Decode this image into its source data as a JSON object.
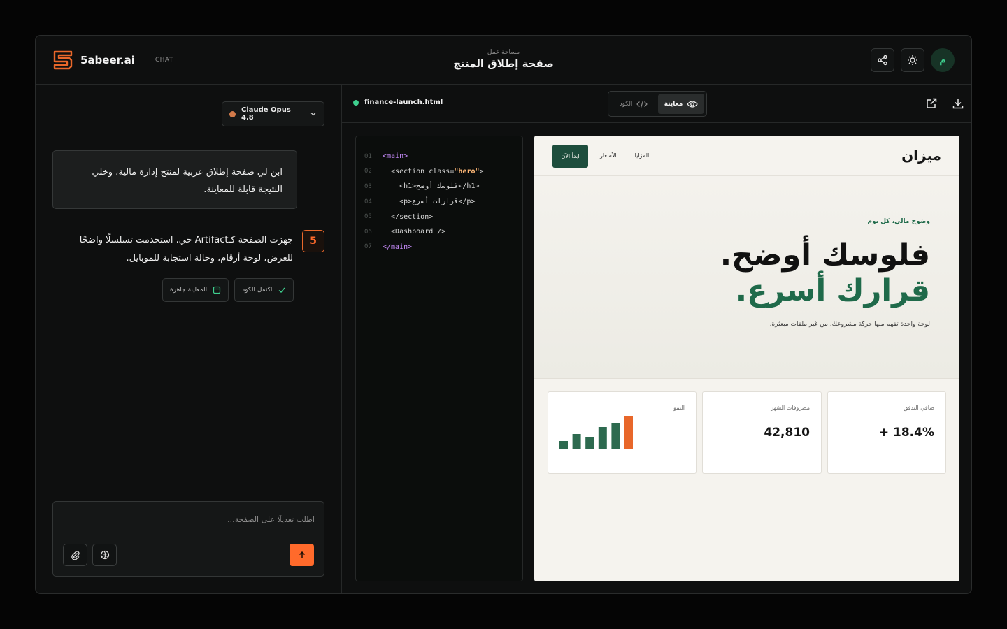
{
  "header": {
    "brand": "5abeer.ai",
    "mode": "CHAT",
    "workspace_label": "مساحة عمل",
    "title": "صفحة إطلاق المنتج",
    "avatar_initial": "م",
    "share_icon": "share-icon",
    "theme_icon": "sun-icon"
  },
  "chat": {
    "model": "Claude Opus 4.8",
    "user_message": "ابن لي صفحة إطلاق عربية لمنتج إدارة مالية، وخلي النتيجة قابلة للمعاينة.",
    "assistant_badge": "5",
    "assistant_message": "جهزت الصفحة كـArtifact حي. استخدمت تسلسلًا واضحًا للعرض، لوحة أرقام، وحالة استجابة للموبايل.",
    "chips": [
      {
        "label": "المعاينة جاهزة",
        "icon": "window-icon"
      },
      {
        "label": "اكتمل الكود",
        "icon": "check-icon"
      }
    ],
    "composer_placeholder": "اطلب تعديلًا على الصفحة..."
  },
  "artifact": {
    "file_name": "finance-launch.html",
    "tabs": [
      {
        "label": "الكود",
        "icon": "code-icon",
        "active": false
      },
      {
        "label": "معاينة",
        "icon": "eye-icon",
        "active": true
      }
    ],
    "code_lines": [
      {
        "n": "01",
        "parts": [
          [
            "tag",
            "<main>"
          ]
        ]
      },
      {
        "n": "02",
        "parts": [
          [
            "txt",
            "  <section class="
          ],
          [
            "str",
            "\"hero\""
          ],
          [
            "txt",
            ">"
          ]
        ]
      },
      {
        "n": "03",
        "parts": [
          [
            "txt",
            "    <h1>فلوسك أوضح</h1>"
          ]
        ]
      },
      {
        "n": "04",
        "parts": [
          [
            "txt",
            "    <p>قرارات أسرع</p>"
          ]
        ]
      },
      {
        "n": "05",
        "parts": [
          [
            "txt",
            "  </section>"
          ]
        ]
      },
      {
        "n": "06",
        "parts": [
          [
            "txt",
            "  <Dashboard />"
          ]
        ]
      },
      {
        "n": "07",
        "parts": [
          [
            "tag",
            "</main>"
          ]
        ]
      }
    ],
    "preview": {
      "logo": "ميزان",
      "nav_links": [
        "المزايا",
        "الأسعار"
      ],
      "cta": "ابدأ الآن",
      "eyebrow": "وضوح مالي، كل يوم",
      "headline_1": "فلوسك أوضح.",
      "headline_2": "قرارك أسرع.",
      "subtitle": "لوحة واحدة تفهم منها حركة مشروعك، من غير ملفات مبعثرة.",
      "cards": [
        {
          "label": "النمو",
          "value": ""
        },
        {
          "label": "مصروفات الشهر",
          "value": "42,810"
        },
        {
          "label": "صافي التدفق",
          "value": "+ 18.4%"
        }
      ]
    }
  },
  "chart_data": {
    "type": "bar",
    "categories": [
      "1",
      "2",
      "3",
      "4",
      "5",
      "6"
    ],
    "values": [
      12,
      22,
      18,
      32,
      38,
      48
    ],
    "highlight_index": 5,
    "colors": {
      "bar": "#2d6a4f",
      "highlight": "#e8672a"
    }
  }
}
